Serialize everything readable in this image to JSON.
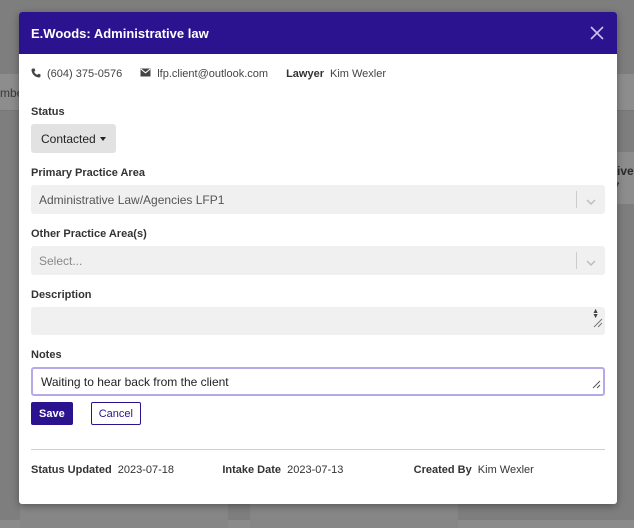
{
  "background": {
    "bar_text": "mbe",
    "card_right_line1": "tive",
    "card_right_line2": "7"
  },
  "modal": {
    "title": "E.Woods: Administrative law",
    "close_icon": "close-icon"
  },
  "contact": {
    "phone": "(604) 375-0576",
    "email": "lfp.client@outlook.com",
    "lawyer_label": "Lawyer",
    "lawyer_name": "Kim Wexler"
  },
  "status": {
    "label": "Status",
    "value": "Contacted"
  },
  "primary_area": {
    "label": "Primary Practice Area",
    "value": "Administrative Law/Agencies LFP1"
  },
  "other_area": {
    "label": "Other Practice Area(s)",
    "placeholder": "Select..."
  },
  "description": {
    "label": "Description",
    "value": ""
  },
  "notes": {
    "label": "Notes",
    "value": "Waiting to hear back from the client"
  },
  "buttons": {
    "save": "Save",
    "cancel": "Cancel"
  },
  "footer": {
    "status_updated_label": "Status Updated",
    "status_updated_value": "2023-07-18",
    "intake_date_label": "Intake Date",
    "intake_date_value": "2023-07-13",
    "created_by_label": "Created By",
    "created_by_value": "Kim Wexler"
  },
  "colors": {
    "header": "#2b1390",
    "overlay": "#808080",
    "notes_focus": "#b7a9e6"
  }
}
